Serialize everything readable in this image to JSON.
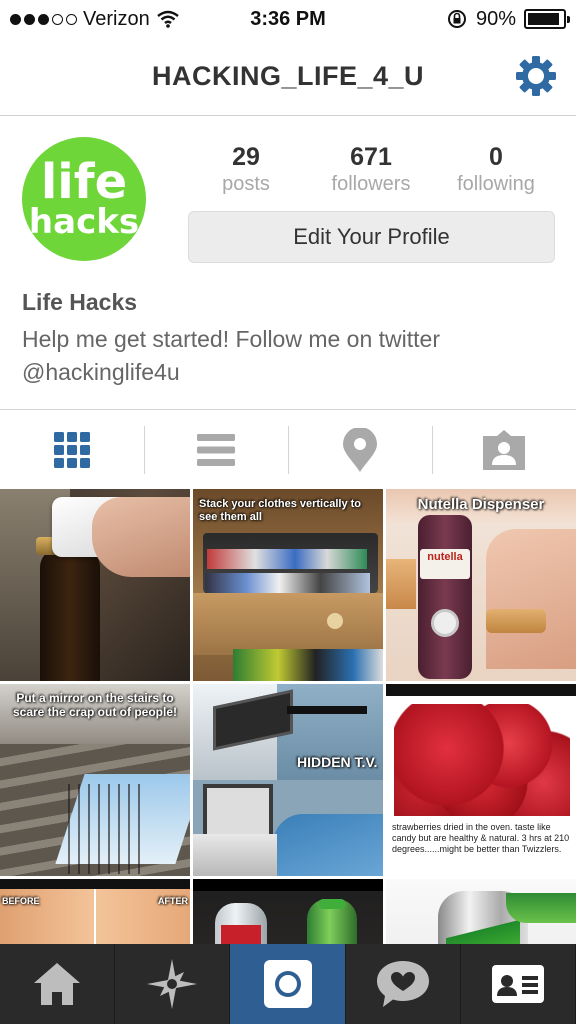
{
  "status_bar": {
    "carrier": "Verizon",
    "time": "3:36 PM",
    "battery": "90%",
    "battery_level": 0.9,
    "signal_bars_filled": 3,
    "signal_bars_total": 5
  },
  "nav": {
    "title": "HACKING_LIFE_4_U",
    "settings_icon": "gear-icon"
  },
  "profile": {
    "avatar_text_line1": "life",
    "avatar_text_line2": "hacks",
    "stats": [
      {
        "value": "29",
        "label": "posts"
      },
      {
        "value": "671",
        "label": "followers"
      },
      {
        "value": "0",
        "label": "following"
      }
    ],
    "edit_button": "Edit Your Profile",
    "name": "Life Hacks",
    "bio": "Help me get started! Follow me on twitter @hackinglife4u"
  },
  "view_tabs": [
    {
      "icon": "grid-icon",
      "active": true
    },
    {
      "icon": "list-icon",
      "active": false
    },
    {
      "icon": "map-pin-icon",
      "active": false
    },
    {
      "icon": "tagged-person-icon",
      "active": false
    }
  ],
  "posts": [
    {
      "caption": "",
      "subcaption": ""
    },
    {
      "caption": "Stack your clothes vertically to see them all",
      "subcaption": ""
    },
    {
      "caption": "Nutella Dispenser",
      "subcaption": "nutella"
    },
    {
      "caption": "Put a mirror on the stairs to scare the crap out of people!",
      "subcaption": ""
    },
    {
      "caption": "HIDDEN T.V.",
      "subcaption": ""
    },
    {
      "caption": "strawberries dried in the oven. taste like candy but are healthy & natural. 3 hrs at 210 degrees......might be better than Twizzlers.",
      "subcaption": ""
    },
    {
      "caption": "BEFORE",
      "subcaption": "AFTER"
    },
    {
      "caption": "",
      "subcaption": ""
    },
    {
      "caption": "",
      "subcaption": ""
    }
  ],
  "tab_bar": [
    {
      "icon": "home-icon",
      "active": false
    },
    {
      "icon": "explore-star-icon",
      "active": false
    },
    {
      "icon": "camera-icon",
      "active": true
    },
    {
      "icon": "activity-heart-icon",
      "active": false
    },
    {
      "icon": "profile-card-icon",
      "active": false
    }
  ],
  "colors": {
    "accent_blue": "#2f6aa3",
    "active_tab_bg": "#2f5f92",
    "tab_bar_bg": "#2a2a2a",
    "avatar_green": "#6fd63a"
  }
}
